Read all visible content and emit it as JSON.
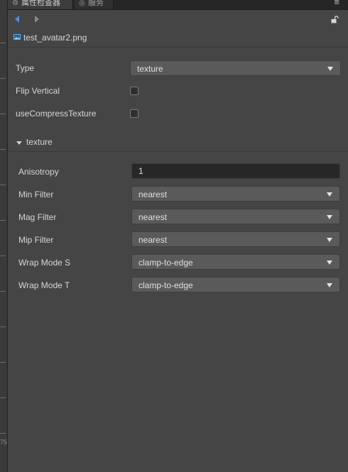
{
  "tabs": [
    {
      "label": "属性检查器",
      "icon": "gear-icon"
    },
    {
      "label": "服务",
      "icon": "eye-icon"
    }
  ],
  "left_strip_text": "75",
  "asset": {
    "name": "test_avatar2.png",
    "icon": "image-icon"
  },
  "properties": {
    "type": {
      "label": "Type",
      "value": "texture"
    },
    "flip_vertical": {
      "label": "Flip Vertical",
      "checked": false
    },
    "use_compress": {
      "label": "useCompressTexture",
      "checked": false
    }
  },
  "section": {
    "title": "texture"
  },
  "texture": {
    "anisotropy": {
      "label": "Anisotropy",
      "value": "1"
    },
    "min_filter": {
      "label": "Min Filter",
      "value": "nearest"
    },
    "mag_filter": {
      "label": "Mag Filter",
      "value": "nearest"
    },
    "mip_filter": {
      "label": "Mip Filter",
      "value": "nearest"
    },
    "wrap_s": {
      "label": "Wrap Mode S",
      "value": "clamp-to-edge"
    },
    "wrap_t": {
      "label": "Wrap Mode T",
      "value": "clamp-to-edge"
    }
  },
  "colors": {
    "panel": "#454545",
    "accent": "#4a90e2",
    "select": "#5a5a5a",
    "input": "#272727"
  }
}
